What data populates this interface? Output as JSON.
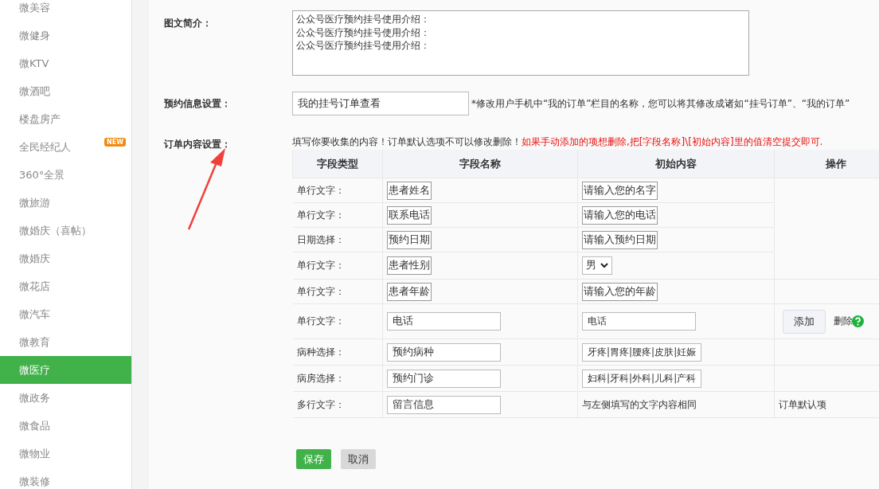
{
  "sidebar": {
    "items": [
      {
        "label": "微美容",
        "selected": false
      },
      {
        "label": "微健身",
        "selected": false
      },
      {
        "label": "微KTV",
        "selected": false
      },
      {
        "label": "微酒吧",
        "selected": false
      },
      {
        "label": "楼盘房产",
        "selected": false
      },
      {
        "label": "全民经纪人",
        "selected": false,
        "badge": "NEW"
      },
      {
        "label": "360°全景",
        "selected": false
      },
      {
        "label": "微旅游",
        "selected": false
      },
      {
        "label": "微婚庆（喜帖）",
        "selected": false
      },
      {
        "label": "微婚庆",
        "selected": false
      },
      {
        "label": "微花店",
        "selected": false
      },
      {
        "label": "微汽车",
        "selected": false
      },
      {
        "label": "微教育",
        "selected": false
      },
      {
        "label": "微医疗",
        "selected": true
      },
      {
        "label": "微政务",
        "selected": false
      },
      {
        "label": "微食品",
        "selected": false
      },
      {
        "label": "微物业",
        "selected": false
      },
      {
        "label": "微装修",
        "selected": false
      }
    ]
  },
  "intro": {
    "label": "图文简介：",
    "lines": [
      "公众号医疗预约挂号使用介绍：",
      "公众号医疗预约挂号使用介绍：",
      "公众号医疗预约挂号使用介绍："
    ]
  },
  "booking": {
    "label": "预约信息设置：",
    "value": "我的挂号订单查看",
    "hint": "*修改用户手机中“我的订单”栏目的名称，您可以将其修改成诸如“挂号订单”、“我的订单”"
  },
  "order": {
    "label": "订单内容设置：",
    "note": "填写你要收集的内容！订单默认选项不可以修改删除！",
    "warning": "如果手动添加的项想删除,把[字段名称]\\[初始内容]里的值清空提交即可.",
    "columns": [
      "字段类型",
      "字段名称",
      "初始内容",
      "操作"
    ],
    "rows": [
      {
        "type": "单行文字：",
        "name": {
          "kind": "small",
          "value": "患者姓名"
        },
        "initial": {
          "kind": "small",
          "value": "请输入您的名字"
        }
      },
      {
        "type": "单行文字：",
        "name": {
          "kind": "small",
          "value": "联系电话"
        },
        "initial": {
          "kind": "small",
          "value": "请输入您的电话"
        }
      },
      {
        "type": "日期选择：",
        "name": {
          "kind": "small",
          "value": "预约日期"
        },
        "initial": {
          "kind": "small",
          "value": "请输入预约日期"
        }
      },
      {
        "type": "单行文字：",
        "name": {
          "kind": "small",
          "value": "患者性别"
        },
        "initial": {
          "kind": "select",
          "value": "男"
        }
      },
      {
        "type": "单行文字：",
        "name": {
          "kind": "small",
          "value": "患者年龄"
        },
        "initial": {
          "kind": "small",
          "value": "请输入您的年龄"
        },
        "action": {
          "kind": "blank"
        }
      },
      {
        "type": "单行文字：",
        "name": {
          "kind": "wide",
          "value": "电话"
        },
        "initial": {
          "kind": "wide",
          "value": "电话"
        },
        "action": {
          "kind": "add",
          "button": "添加",
          "link": "删除"
        }
      },
      {
        "type": "病种选择：",
        "name": {
          "kind": "wide",
          "value": "预约病种"
        },
        "initial": {
          "kind": "wide",
          "value": "牙疼|胃疼|腰疼|皮肤|妊娠"
        },
        "action": {
          "kind": "blank"
        }
      },
      {
        "type": "病房选择：",
        "name": {
          "kind": "wide",
          "value": "预约门诊"
        },
        "initial": {
          "kind": "wide",
          "value": "妇科|牙科|外科|儿科|产科"
        },
        "action": {
          "kind": "blank"
        }
      },
      {
        "type": "多行文字：",
        "name": {
          "kind": "wide",
          "value": "留言信息"
        },
        "initial": {
          "kind": "text",
          "value": "与左侧填写的文字内容相同"
        },
        "action": {
          "kind": "text",
          "text": "订单默认项"
        }
      }
    ]
  },
  "buttons": {
    "save": "保存",
    "cancel": "取消"
  }
}
